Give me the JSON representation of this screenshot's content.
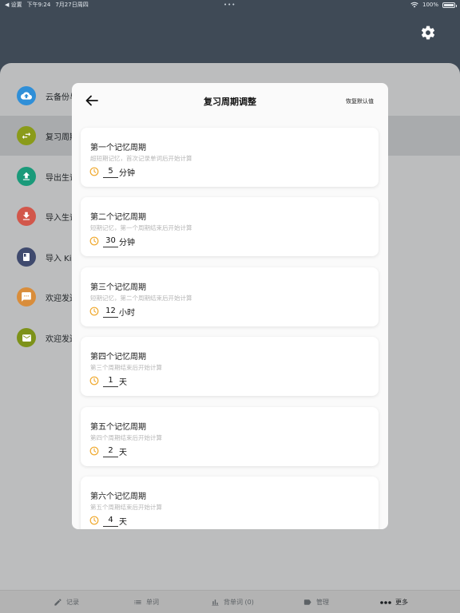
{
  "status": {
    "back_app": "◀ 设置",
    "time": "下午9:24",
    "date": "7月27日周四",
    "dots": "•••",
    "battery": "100%"
  },
  "menu": [
    {
      "label": "云备份与",
      "color": "#2f8fd8",
      "icon": "cloud-upload-icon"
    },
    {
      "label": "复习周期",
      "color": "#8a9b1a",
      "icon": "cycle-arrows-icon",
      "active": true
    },
    {
      "label": "导出生词",
      "color": "#1a9a7a",
      "icon": "upload-icon"
    },
    {
      "label": "导入生词",
      "color": "#d2574b",
      "icon": "download-icon"
    },
    {
      "label": "导入 Kin",
      "color": "#3f4a6e",
      "icon": "book-icon"
    },
    {
      "label": "欢迎发送",
      "color": "#d98d3b",
      "icon": "chat-icon"
    },
    {
      "label": "欢迎发送",
      "color": "#7d9219",
      "icon": "mail-icon"
    }
  ],
  "tabs": [
    {
      "label": "记录",
      "icon": "pencil-icon"
    },
    {
      "label": "单词",
      "icon": "list-icon"
    },
    {
      "label": "背单词 (0)",
      "icon": "bar-chart-icon"
    },
    {
      "label": "管理",
      "icon": "tag-icon"
    },
    {
      "label": "更多",
      "icon": "more-dots-icon",
      "active": true
    }
  ],
  "modal": {
    "title": "复习周期调整",
    "reset_label": "恢复默认值",
    "cards": [
      {
        "title": "第一个记忆周期",
        "desc": "超短期记忆，首次记录单词后开始计算",
        "value": "5",
        "unit": "分钟"
      },
      {
        "title": "第二个记忆周期",
        "desc": "短期记忆，第一个周期结束后开始计算",
        "value": "30",
        "unit": "分钟"
      },
      {
        "title": "第三个记忆周期",
        "desc": "短期记忆，第二个周期结束后开始计算",
        "value": "12",
        "unit": "小时"
      },
      {
        "title": "第四个记忆周期",
        "desc": "第三个周期结束后开始计算",
        "value": "1",
        "unit": "天"
      },
      {
        "title": "第五个记忆周期",
        "desc": "第四个周期结束后开始计算",
        "value": "2",
        "unit": "天"
      },
      {
        "title": "第六个记忆周期",
        "desc": "第五个周期结束后开始计算",
        "value": "4",
        "unit": "天"
      }
    ]
  },
  "colors": {
    "accent_timer": "#f0a92e",
    "header_bg": "#3f4a56",
    "sheet_bg": "#bcbdbe"
  }
}
